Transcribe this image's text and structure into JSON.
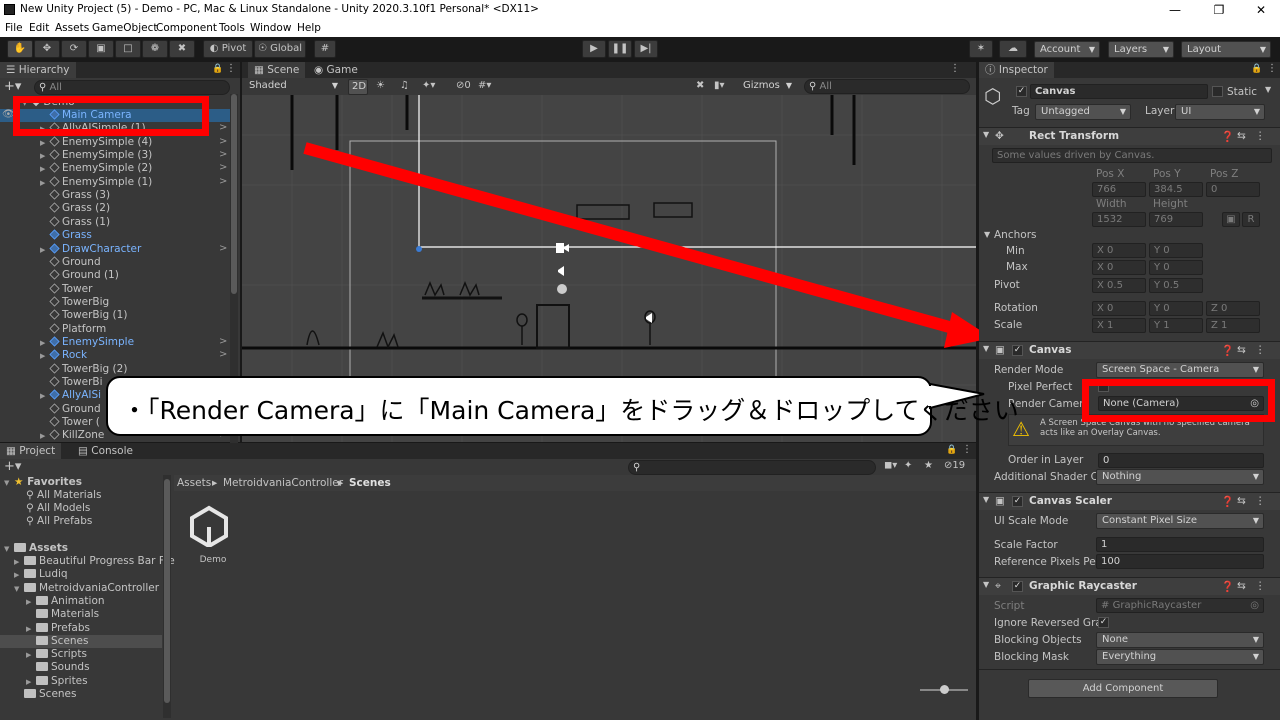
{
  "window": {
    "title": "New Unity Project (5) - Demo - PC, Mac & Linux Standalone - Unity 2020.3.10f1 Personal* <DX11>"
  },
  "menu": [
    "File",
    "Edit",
    "Assets",
    "GameObject",
    "Component",
    "Tools",
    "Window",
    "Help"
  ],
  "toolbar": {
    "pivot": "Pivot",
    "global": "Global",
    "account": "Account",
    "layers": "Layers",
    "layout": "Layout"
  },
  "hierarchy": {
    "tab": "Hierarchy",
    "search_placeholder": "All",
    "scene": "Demo",
    "items": [
      {
        "label": "Main Camera",
        "blue": true,
        "expand": false,
        "depth": 1,
        "selected": true
      },
      {
        "label": "AllyAISimple (1)",
        "blue": false,
        "expand": true,
        "depth": 1
      },
      {
        "label": "EnemySimple (4)",
        "blue": false,
        "expand": true,
        "depth": 1
      },
      {
        "label": "EnemySimple (3)",
        "blue": false,
        "expand": true,
        "depth": 1
      },
      {
        "label": "EnemySimple (2)",
        "blue": false,
        "expand": true,
        "depth": 1
      },
      {
        "label": "EnemySimple (1)",
        "blue": false,
        "expand": true,
        "depth": 1
      },
      {
        "label": "Grass (3)",
        "blue": false,
        "expand": false,
        "depth": 1
      },
      {
        "label": "Grass (2)",
        "blue": false,
        "expand": false,
        "depth": 1
      },
      {
        "label": "Grass (1)",
        "blue": false,
        "expand": false,
        "depth": 1
      },
      {
        "label": "Grass",
        "blue": true,
        "expand": false,
        "depth": 1
      },
      {
        "label": "DrawCharacter",
        "blue": true,
        "expand": true,
        "depth": 1
      },
      {
        "label": "Ground",
        "blue": false,
        "expand": false,
        "depth": 1
      },
      {
        "label": "Ground (1)",
        "blue": false,
        "expand": false,
        "depth": 1
      },
      {
        "label": "Tower",
        "blue": false,
        "expand": false,
        "depth": 1
      },
      {
        "label": "TowerBig",
        "blue": false,
        "expand": false,
        "depth": 1
      },
      {
        "label": "TowerBig (1)",
        "blue": false,
        "expand": false,
        "depth": 1
      },
      {
        "label": "Platform",
        "blue": false,
        "expand": false,
        "depth": 1
      },
      {
        "label": "EnemySimple",
        "blue": true,
        "expand": true,
        "depth": 1
      },
      {
        "label": "Rock",
        "blue": true,
        "expand": true,
        "depth": 1
      },
      {
        "label": "TowerBig (2)",
        "blue": false,
        "expand": false,
        "depth": 1
      },
      {
        "label": "TowerBi",
        "blue": false,
        "expand": false,
        "depth": 1
      },
      {
        "label": "AllyAISi",
        "blue": true,
        "expand": true,
        "depth": 1
      },
      {
        "label": "Ground",
        "blue": false,
        "expand": false,
        "depth": 1
      },
      {
        "label": "Tower (",
        "blue": false,
        "expand": false,
        "depth": 1
      },
      {
        "label": "KillZone",
        "blue": false,
        "expand": true,
        "depth": 1
      }
    ]
  },
  "scene": {
    "tab_scene": "Scene",
    "tab_game": "Game",
    "shading": "Shaded",
    "mode_2d": "2D",
    "fx_count": "0",
    "gizmos": "Gizmos",
    "search_placeholder": "All"
  },
  "callout": "・「Render Camera」に「Main Camera」をドラッグ＆ドロップしてください",
  "project": {
    "tab_project": "Project",
    "tab_console": "Console",
    "hidden_count": "19",
    "favorites_label": "Favorites",
    "favorites": [
      "All Materials",
      "All Models",
      "All Prefabs"
    ],
    "assets_label": "Assets",
    "folders": [
      {
        "label": "Beautiful Progress Bar Fre",
        "depth": 1,
        "expand": true
      },
      {
        "label": "Ludiq",
        "depth": 1,
        "expand": true
      },
      {
        "label": "MetroidvaniaController",
        "depth": 1,
        "expand": "open"
      },
      {
        "label": "Animation",
        "depth": 2,
        "expand": true
      },
      {
        "label": "Materials",
        "depth": 2,
        "expand": false
      },
      {
        "label": "Prefabs",
        "depth": 2,
        "expand": true
      },
      {
        "label": "Scenes",
        "depth": 2,
        "expand": false,
        "selected": true
      },
      {
        "label": "Scripts",
        "depth": 2,
        "expand": true
      },
      {
        "label": "Sounds",
        "depth": 2,
        "expand": false
      },
      {
        "label": "Sprites",
        "depth": 2,
        "expand": true
      },
      {
        "label": "Scenes",
        "depth": 1,
        "expand": false
      }
    ],
    "breadcrumb": [
      "Assets",
      "MetroidvaniaController",
      "Scenes"
    ],
    "asset_name": "Demo"
  },
  "inspector": {
    "tab": "Inspector",
    "object_name": "Canvas",
    "static_label": "Static",
    "tag_label": "Tag",
    "tag_value": "Untagged",
    "layer_label": "Layer",
    "layer_value": "UI",
    "rect_transform": {
      "title": "Rect Transform",
      "note": "Some values driven by Canvas.",
      "pos_x_label": "Pos X",
      "pos_y_label": "Pos Y",
      "pos_z_label": "Pos Z",
      "pos_x": "766",
      "pos_y": "384.5",
      "pos_z": "0",
      "width_label": "Width",
      "height_label": "Height",
      "width": "1532",
      "height": "769",
      "r_btn": "R",
      "anchors_label": "Anchors",
      "min_label": "Min",
      "max_label": "Max",
      "anchor_min_x": "0",
      "anchor_min_y": "0",
      "anchor_max_x": "0",
      "anchor_max_y": "0",
      "pivot_label": "Pivot",
      "pivot_x": "0.5",
      "pivot_y": "0.5",
      "rotation_label": "Rotation",
      "rot_x": "0",
      "rot_y": "0",
      "rot_z": "0",
      "scale_label": "Scale",
      "scale_x": "1",
      "scale_y": "1",
      "scale_z": "1",
      "x": "X",
      "y": "Y",
      "z": "Z"
    },
    "canvas": {
      "title": "Canvas",
      "render_mode_label": "Render Mode",
      "render_mode": "Screen Space - Camera",
      "pixel_perfect_label": "Pixel Perfect",
      "render_camera_label": "Render Camera",
      "render_camera": "None (Camera)",
      "warning": "A Screen Space Canvas with no specified camera acts like an Overlay Canvas.",
      "order_label": "Order in Layer",
      "order": "0",
      "shader_label": "Additional Shader Ch",
      "shader": "Nothing"
    },
    "scaler": {
      "title": "Canvas Scaler",
      "ui_scale_label": "UI Scale Mode",
      "ui_scale": "Constant Pixel Size",
      "scale_factor_label": "Scale Factor",
      "scale_factor": "1",
      "ref_ppu_label": "Reference Pixels Per",
      "ref_ppu": "100"
    },
    "raycaster": {
      "title": "Graphic Raycaster",
      "script_label": "Script",
      "script": "GraphicRaycaster",
      "ignore_label": "Ignore Reversed Grap",
      "blocking_obj_label": "Blocking Objects",
      "blocking_obj": "None",
      "blocking_mask_label": "Blocking Mask",
      "blocking_mask": "Everything"
    },
    "add_component": "Add Component"
  },
  "colors": {
    "highlight_red": "#ff0000",
    "selection_blue": "#2c5d87",
    "unity_blue_text": "#7ab4ff"
  }
}
